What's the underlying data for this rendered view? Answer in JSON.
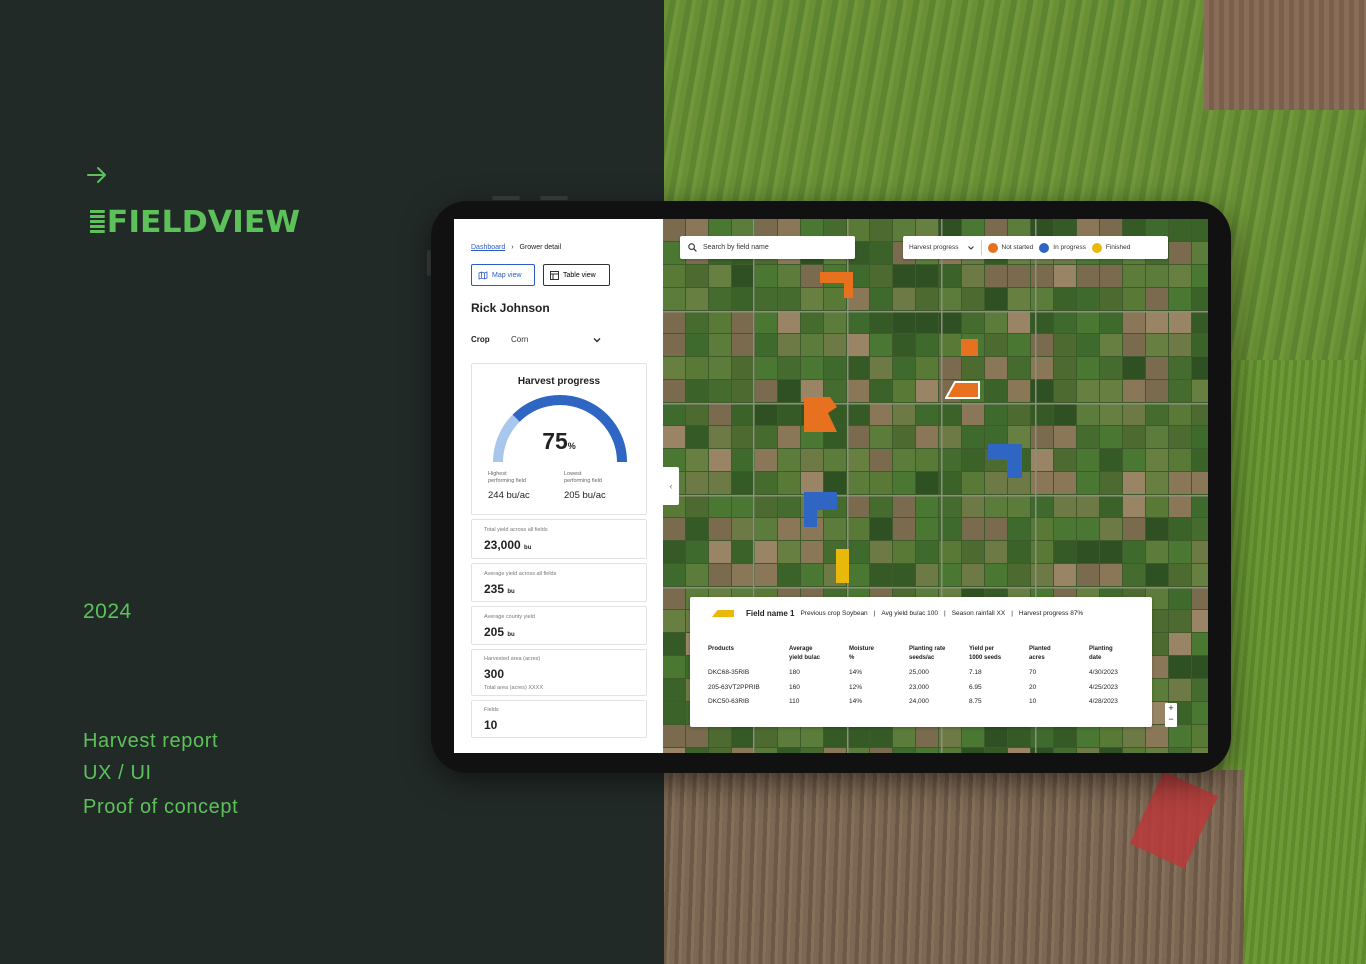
{
  "brand": {
    "logo_text": "FIELDVIEW",
    "logo_color": "#5dc15a",
    "arrow_icon": "arrow-right-icon"
  },
  "year": "2024",
  "subtitles": [
    "Harvest report",
    "UX / UI",
    "Proof of concept"
  ],
  "breadcrumb": {
    "link": "Dashboard",
    "current": "Grower detail"
  },
  "views": {
    "map": "Map view",
    "table": "Table view"
  },
  "grower": "Rick Johnson",
  "crop": {
    "label": "Crop",
    "value": "Corn"
  },
  "harvest": {
    "title": "Harvest progress",
    "percent": "75",
    "percent_sign": "%",
    "progress_fraction": 0.75,
    "highest_label_1": "Highest",
    "highest_label_2": "performing field",
    "highest_value": "244 bu/ac",
    "lowest_label_1": "Lowest",
    "lowest_label_2": "performing field",
    "lowest_value": "205 bu/ac"
  },
  "stats": {
    "total_yield": {
      "label": "Total yield across all fields",
      "value": "23,000",
      "unit": "bu"
    },
    "avg_yield": {
      "label": "Average yield across all fields",
      "value": "235",
      "unit": "bu"
    },
    "county_yield": {
      "label": "Average county yield",
      "value": "205",
      "unit": "bu"
    },
    "harvested": {
      "label": "Harvested area (acres)",
      "value": "300",
      "sub": "Total area (acres) XXXX"
    },
    "fields": {
      "label": "Fields",
      "value": "10"
    }
  },
  "map": {
    "search_placeholder": "Search by field name",
    "filter": "Harvest progress",
    "legend": [
      {
        "label": "Not started",
        "color": "#e8711f"
      },
      {
        "label": "In progress",
        "color": "#2f66c4"
      },
      {
        "label": "Finished",
        "color": "#e8b90b"
      }
    ],
    "zoom_in": "+",
    "zoom_out": "−"
  },
  "field_info": {
    "name": "Field name 1",
    "prev_crop": "Previous crop Soybean",
    "avg_yield": "Avg yield bu/ac 100",
    "rainfall": "Season rainfall XX",
    "progress": "Harvest progress 87%",
    "divider": "|",
    "headers": [
      [
        "Products",
        ""
      ],
      [
        "Average",
        "yield bu/ac"
      ],
      [
        "Moisture",
        "%"
      ],
      [
        "Planting rate",
        "seeds/ac"
      ],
      [
        "Yield per",
        "1000 seeds"
      ],
      [
        "Planted",
        "acres"
      ],
      [
        "Planting",
        "date"
      ]
    ],
    "rows": [
      [
        "DKC68-35RIB",
        "180",
        "14%",
        "25,000",
        "7.18",
        "70",
        "4/30/2023"
      ],
      [
        "205-63VT2PPRIB",
        "160",
        "12%",
        "23,000",
        "6.95",
        "20",
        "4/25/2023"
      ],
      [
        "DKC50-63RIB",
        "110",
        "14%",
        "24,000",
        "8.75",
        "10",
        "4/28/2023"
      ]
    ]
  }
}
